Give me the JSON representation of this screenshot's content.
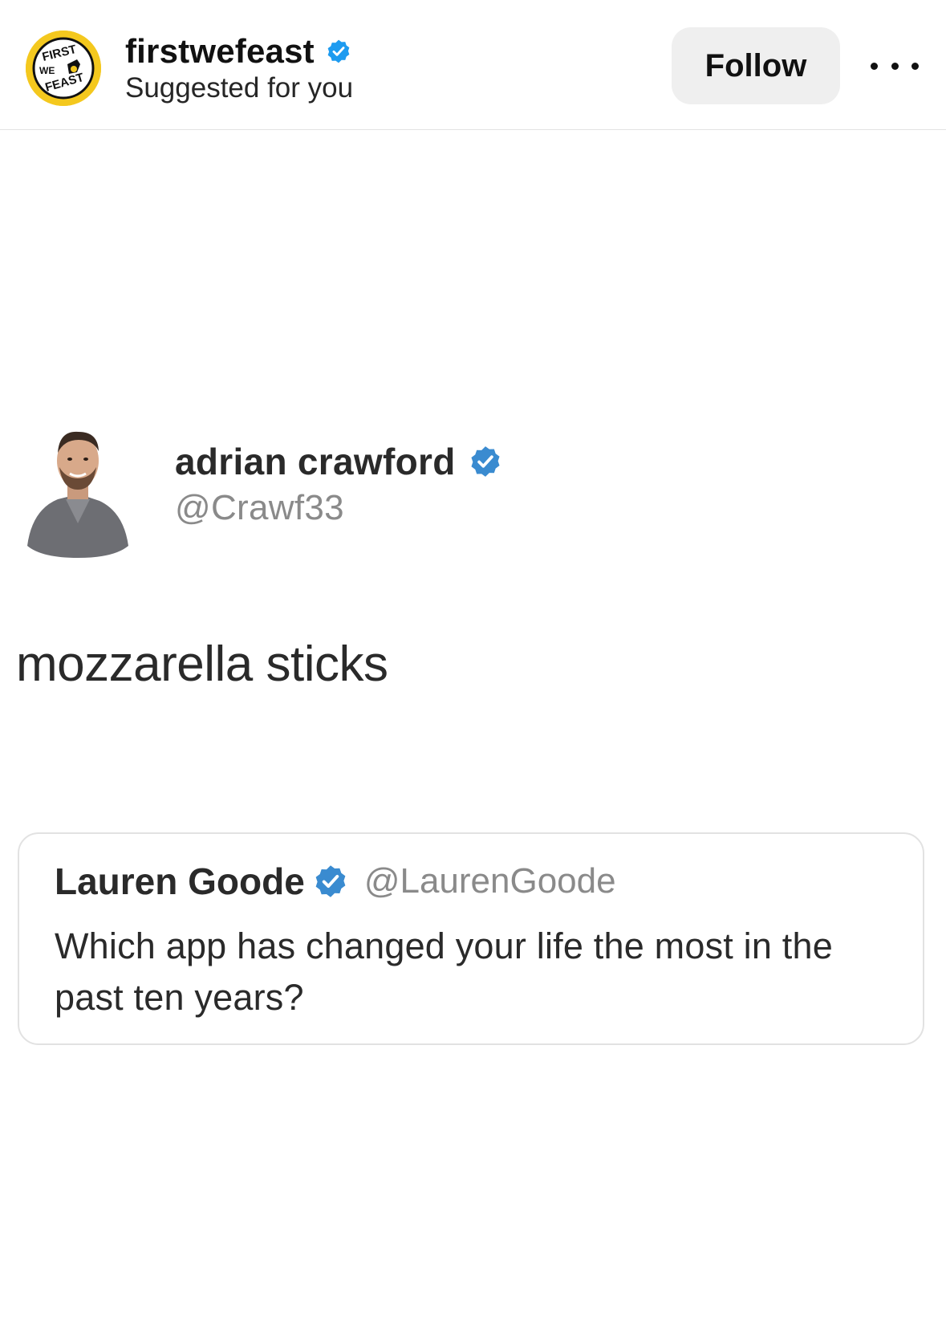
{
  "post": {
    "account_name": "firstwefeast",
    "subtitle": "Suggested for you",
    "follow_label": "Follow",
    "more_icon": "more-horizontal-icon",
    "avatar_logo_text": [
      "FIRST",
      "WE",
      "FEAST"
    ],
    "avatar_color": "#f4c81e"
  },
  "tweet": {
    "author_name": "adrian crawford",
    "author_handle": "@Crawf33",
    "text": "mozzarella sticks",
    "quoted": {
      "author_name": "Lauren Goode",
      "author_handle": "@LaurenGoode",
      "text": "Which app has changed your life the most in the past ten years?"
    }
  },
  "colors": {
    "ig_verified": "#1d9bf0",
    "twitter_verified": "#3a8bd0",
    "follow_button_bg": "#efefef"
  }
}
